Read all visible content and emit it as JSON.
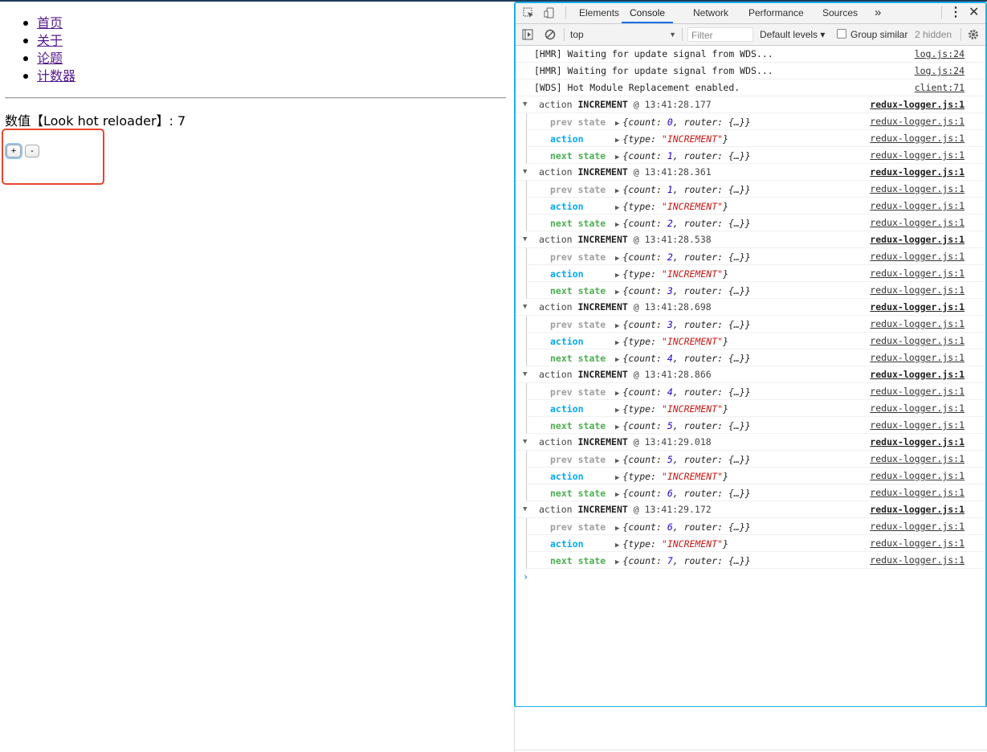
{
  "page": {
    "nav": [
      "首页",
      "关于",
      "论题",
      "计数器"
    ],
    "counter_label": "数值【Look hot reloader】: 7",
    "increment_label": "+",
    "decrement_label": "-"
  },
  "devtools": {
    "tabs": [
      "Elements",
      "Console",
      "Network",
      "Performance",
      "Sources"
    ],
    "more_tabs": "»",
    "active_tab": "Console",
    "context": "top",
    "filter_placeholder": "Filter",
    "levels": "Default levels ▾",
    "group_similar": "Group similar",
    "hidden": "2 hidden",
    "accent_color": "#1ab0e8",
    "plain_logs": [
      {
        "text": "[HMR] Waiting for update signal from WDS...",
        "src": "log.js:24"
      },
      {
        "text": "[HMR] Waiting for update signal from WDS...",
        "src": "log.js:24"
      },
      {
        "text": "[WDS] Hot Module Replacement enabled.",
        "src": "client:71"
      }
    ],
    "groups": [
      {
        "prefix": "action",
        "type": "INCREMENT",
        "time": "@ 13:41:28.177",
        "src": "redux-logger.js:1",
        "prev": "0",
        "next": "1"
      },
      {
        "prefix": "action",
        "type": "INCREMENT",
        "time": "@ 13:41:28.361",
        "src": "redux-logger.js:1",
        "prev": "1",
        "next": "2"
      },
      {
        "prefix": "action",
        "type": "INCREMENT",
        "time": "@ 13:41:28.538",
        "src": "redux-logger.js:1",
        "prev": "2",
        "next": "3"
      },
      {
        "prefix": "action",
        "type": "INCREMENT",
        "time": "@ 13:41:28.698",
        "src": "redux-logger.js:1",
        "prev": "3",
        "next": "4"
      },
      {
        "prefix": "action",
        "type": "INCREMENT",
        "time": "@ 13:41:28.866",
        "src": "redux-logger.js:1",
        "prev": "4",
        "next": "5"
      },
      {
        "prefix": "action",
        "type": "INCREMENT",
        "time": "@ 13:41:29.018",
        "src": "redux-logger.js:1",
        "prev": "5",
        "next": "6"
      },
      {
        "prefix": "action",
        "type": "INCREMENT",
        "time": "@ 13:41:29.172",
        "src": "redux-logger.js:1",
        "prev": "6",
        "next": "7"
      }
    ],
    "labels": {
      "prev": "prev state",
      "action": "action",
      "next": "next state"
    },
    "child_src": "redux-logger.js:1",
    "action_payload": "\"INCREMENT\"",
    "prompt": "›"
  }
}
